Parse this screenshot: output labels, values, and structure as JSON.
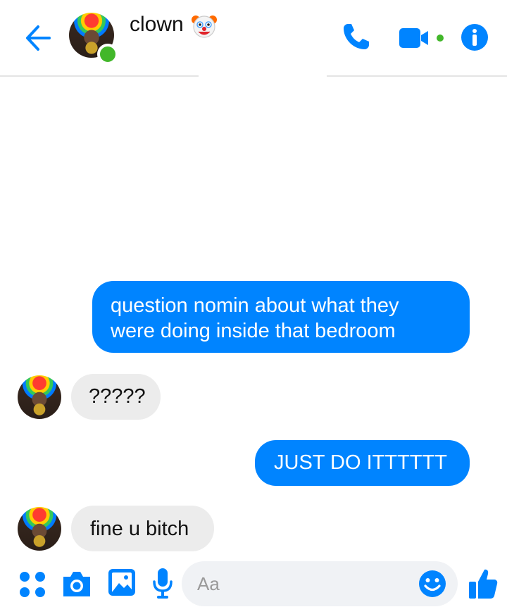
{
  "header": {
    "title": "clown",
    "back_icon": "arrow-left-icon",
    "call_icon": "phone-icon",
    "video_icon": "video-camera-icon",
    "info_icon": "info-icon",
    "accent": "#0084ff",
    "online_color": "#42b72a"
  },
  "messages": [
    {
      "direction": "outgoing",
      "lines": [
        "question nomin about what they",
        "were doing inside that bedroom"
      ]
    },
    {
      "direction": "incoming",
      "text": "?????"
    },
    {
      "direction": "outgoing",
      "text": "JUST DO ITTTTTT"
    },
    {
      "direction": "incoming",
      "text": "fine u bitch"
    }
  ],
  "composer": {
    "placeholder": "Aa",
    "more_icon": "four-dots-icon",
    "camera_icon": "camera-icon",
    "gallery_icon": "image-icon",
    "mic_icon": "microphone-icon",
    "emoji_icon": "smiley-icon",
    "like_icon": "thumbs-up-icon"
  }
}
